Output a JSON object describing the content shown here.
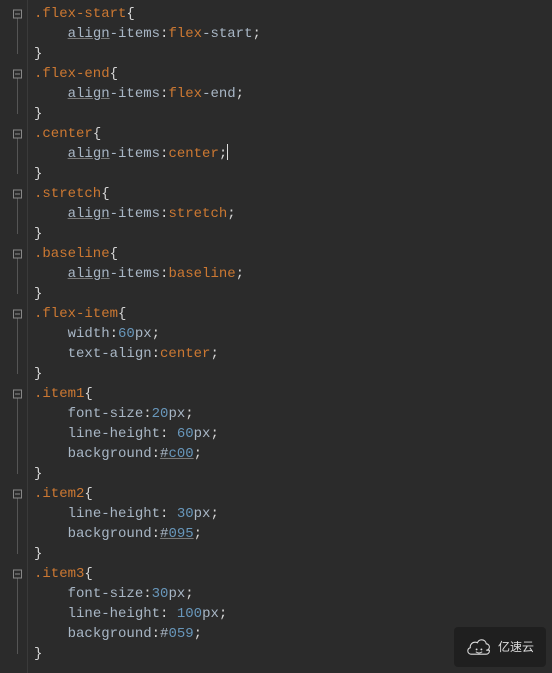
{
  "watermark": "亿速云",
  "code": {
    "rules": [
      {
        "selector": ".flex-start",
        "decls": [
          {
            "prop_pre": "align",
            "prop_post": "-items",
            "val_type": "kw2",
            "val_pre": "flex",
            "val_post": "-start"
          }
        ]
      },
      {
        "selector": ".flex-end",
        "decls": [
          {
            "prop_pre": "align",
            "prop_post": "-items",
            "val_type": "kw2",
            "val_pre": "flex",
            "val_post": "-end"
          }
        ]
      },
      {
        "selector": ".center",
        "decls": [
          {
            "prop_pre": "align",
            "prop_post": "-items",
            "val_type": "kw1",
            "val": "center",
            "cursor_after": true
          }
        ]
      },
      {
        "selector": ".stretch",
        "decls": [
          {
            "prop_pre": "align",
            "prop_post": "-items",
            "val_type": "kw1",
            "val": "stretch"
          }
        ]
      },
      {
        "selector": ".baseline",
        "decls": [
          {
            "prop_pre": "align",
            "prop_post": "-items",
            "val_type": "kw1",
            "val": "baseline"
          }
        ]
      },
      {
        "selector": ".flex-item",
        "decls": [
          {
            "prop_pre": "width",
            "prop_post": "",
            "val_type": "len",
            "num": "60",
            "unit": "px"
          },
          {
            "prop_pre": "text-align",
            "prop_post": "",
            "val_type": "kw1",
            "val": "center"
          }
        ]
      },
      {
        "selector": ".item1",
        "decls": [
          {
            "prop_pre": "font-size",
            "prop_post": "",
            "val_type": "len",
            "num": "20",
            "unit": "px"
          },
          {
            "prop_pre": "line-height",
            "prop_post": "",
            "val_type": "len_sp",
            "num": "60",
            "unit": "px"
          },
          {
            "prop_pre": "background",
            "prop_post": "",
            "val_type": "hex",
            "hex": "c00",
            "hex_underline": true
          }
        ]
      },
      {
        "selector": ".item2",
        "decls": [
          {
            "prop_pre": "line-height",
            "prop_post": "",
            "val_type": "len_sp",
            "num": "30",
            "unit": "px"
          },
          {
            "prop_pre": "background",
            "prop_post": "",
            "val_type": "hex",
            "hex": "095",
            "hex_underline": true
          }
        ]
      },
      {
        "selector": ".item3",
        "decls": [
          {
            "prop_pre": "font-size",
            "prop_post": "",
            "val_type": "len",
            "num": "30",
            "unit": "px"
          },
          {
            "prop_pre": "line-height",
            "prop_post": "",
            "val_type": "len_sp",
            "num": "100",
            "unit": "px"
          },
          {
            "prop_pre": "background",
            "prop_post": "",
            "val_type": "hex",
            "hex": "059"
          }
        ]
      }
    ]
  }
}
